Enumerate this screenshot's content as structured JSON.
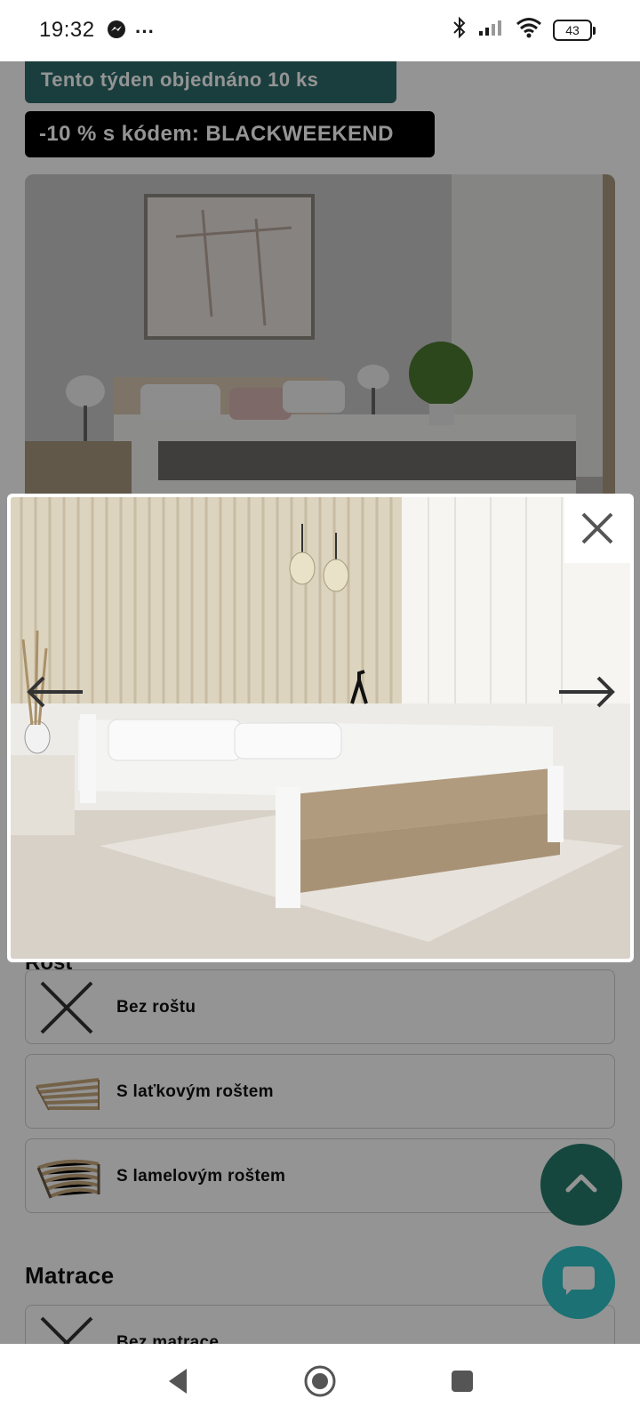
{
  "status_bar": {
    "time": "19:32",
    "messenger_icon": "messenger-icon",
    "more_notifications": "···",
    "battery_level": "43"
  },
  "page": {
    "ordered_badge": "Tento týden objednáno 10 ks",
    "discount_badge": "-10 % s kódem: BLACKWEEKEND",
    "section_rost": "Rošt",
    "rost_options": [
      {
        "label": "Bez roštu",
        "icon": "none-x-icon"
      },
      {
        "label": "S laťkovým roštem",
        "icon": "slat-grid-icon"
      },
      {
        "label": "S lamelovým roštem",
        "icon": "lamella-grid-icon"
      }
    ],
    "section_matrace": "Matrace",
    "matrace_options": [
      {
        "label": "Bez matrace",
        "icon": "none-x-icon"
      }
    ]
  },
  "lightbox": {
    "close_icon": "close-icon",
    "prev_icon": "arrow-left-icon",
    "next_icon": "arrow-right-icon"
  },
  "fabs": {
    "scroll_top_icon": "chevron-up-icon",
    "chat_icon": "chat-bubble-icon"
  },
  "colors": {
    "badge_teal": "#2d6b6a",
    "badge_black": "#000000",
    "fab_green": "#267a6c",
    "fab_cyan": "#2fc3c6"
  }
}
